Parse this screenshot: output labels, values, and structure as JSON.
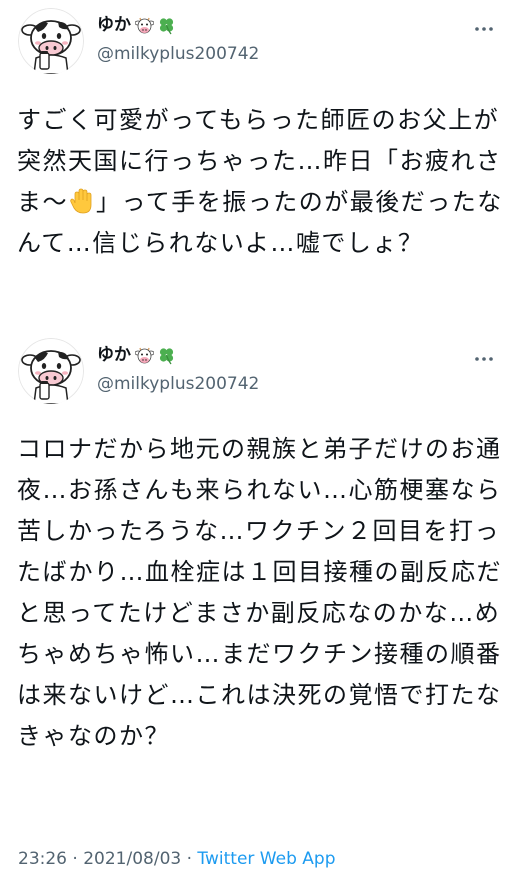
{
  "tweets": [
    {
      "author": {
        "display_name": "ゆか",
        "handle": "@milkyplus200742",
        "emojis": [
          "cow-face-icon",
          "four-leaf-clover-icon"
        ]
      },
      "text_before_emoji": "すごく可愛がってもらった師匠のお父上が突然天国に行っちゃった…昨日「お疲れさま〜",
      "inline_emoji": "raised-hand-icon",
      "text_after_emoji": "」って手を振ったのが最後だったなんて…信じられないよ…嘘でしょ？"
    },
    {
      "author": {
        "display_name": "ゆか",
        "handle": "@milkyplus200742",
        "emojis": [
          "cow-face-icon",
          "four-leaf-clover-icon"
        ]
      },
      "text": "コロナだから地元の親族と弟子だけのお通夜…お孫さんも来られない…心筋梗塞なら苦しかったろうな…ワクチン２回目を打ったばかり…血栓症は１回目接種の副反応だと思ってたけどまさか副反応なのかな…めちゃめちゃ怖い…まだワクチン接種の順番は来ないけど…これは決死の覚悟で打たなきゃなのか？"
    }
  ],
  "meta": {
    "time": "23:26",
    "separator": " · ",
    "date": "2021/08/03",
    "app": "Twitter Web App"
  },
  "colors": {
    "text": "#0f1419",
    "secondary": "#536471",
    "link": "#1d9bf0"
  }
}
